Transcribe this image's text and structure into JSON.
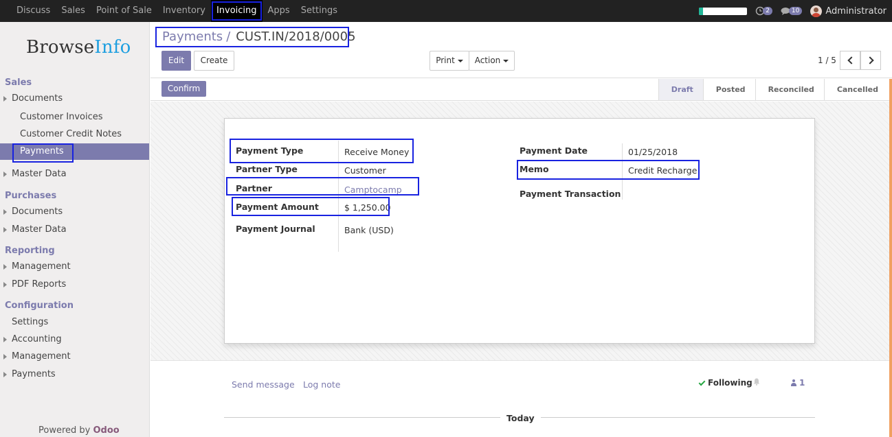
{
  "topbar": {
    "menu": [
      {
        "label": "Discuss",
        "active": false
      },
      {
        "label": "Sales",
        "active": false
      },
      {
        "label": "Point of Sale",
        "active": false
      },
      {
        "label": "Inventory",
        "active": false
      },
      {
        "label": "Invoicing",
        "active": true
      },
      {
        "label": "Apps",
        "active": false
      },
      {
        "label": "Settings",
        "active": false
      }
    ],
    "activity_count": "2",
    "message_count": "10",
    "user_name": "Administrator",
    "progress_fraction": 0.08
  },
  "sidebar": {
    "logo_part1": "Browse",
    "logo_part2": "Info",
    "sections": {
      "sales": "Sales",
      "purchases": "Purchases",
      "reporting": "Reporting",
      "configuration": "Configuration"
    },
    "items": {
      "sales_documents": "Documents",
      "customer_invoices": "Customer Invoices",
      "customer_credit_notes": "Customer Credit Notes",
      "payments": "Payments",
      "sales_master_data": "Master Data",
      "purchases_documents": "Documents",
      "purchases_master_data": "Master Data",
      "reporting_management": "Management",
      "pdf_reports": "PDF Reports",
      "settings": "Settings",
      "accounting": "Accounting",
      "config_management": "Management",
      "config_payments": "Payments"
    },
    "powered_by": "Powered by",
    "powered_brand": "Odoo"
  },
  "control_panel": {
    "breadcrumb_parent": "Payments",
    "breadcrumb_separator": "/",
    "breadcrumb_current": "CUST.IN/2018/0005",
    "edit_label": "Edit",
    "create_label": "Create",
    "print_label": "Print",
    "action_label": "Action",
    "pager": "1 / 5"
  },
  "statusbar": {
    "confirm_label": "Confirm",
    "steps": [
      {
        "label": "Draft",
        "active": true
      },
      {
        "label": "Posted",
        "active": false
      },
      {
        "label": "Reconciled",
        "active": false
      },
      {
        "label": "Cancelled",
        "active": false
      }
    ]
  },
  "form": {
    "payment_type_label": "Payment Type",
    "payment_type_value": "Receive Money",
    "partner_type_label": "Partner Type",
    "partner_type_value": "Customer",
    "partner_label": "Partner",
    "partner_value": "Camptocamp",
    "payment_amount_label": "Payment Amount",
    "payment_amount_value": "$ 1,250.00",
    "payment_journal_label": "Payment Journal",
    "payment_journal_value": "Bank (USD)",
    "payment_date_label": "Payment Date",
    "payment_date_value": "01/25/2018",
    "memo_label": "Memo",
    "memo_value": "Credit Recharge",
    "payment_transaction_label": "Payment Transaction"
  },
  "chatter": {
    "send_message": "Send message",
    "log_note": "Log note",
    "following": "Following",
    "followers_count": "1",
    "today": "Today"
  }
}
